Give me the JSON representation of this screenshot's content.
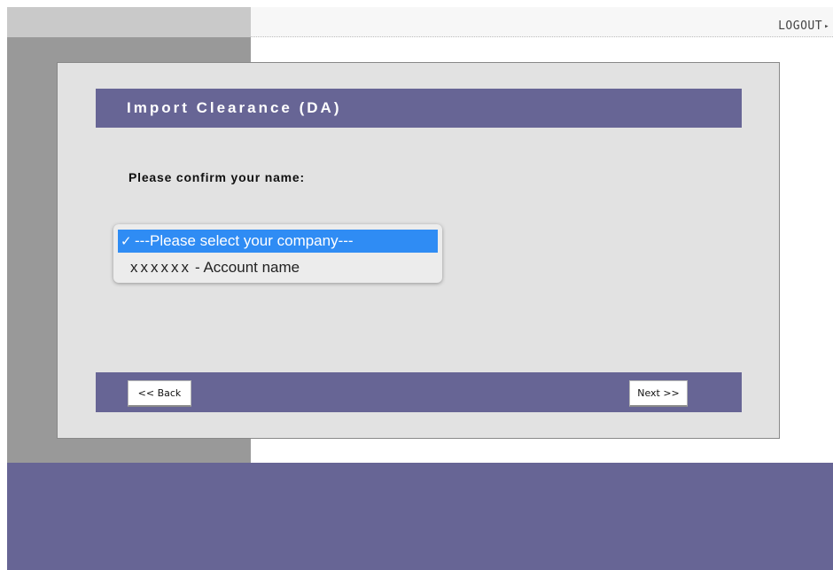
{
  "header": {
    "logout_label": "LOGOUT",
    "logout_arrow": "▸"
  },
  "form": {
    "title": "Import Clearance (DA)",
    "prompt": "Please confirm your name:",
    "company_select": {
      "selected_check": "✓",
      "options": [
        {
          "label": "---Please select your company---",
          "selected": true
        },
        {
          "mask": "xxxxxx",
          "label": "- Account name",
          "selected": false
        }
      ]
    },
    "back_label": "<< Back",
    "next_label": "Next >>"
  },
  "colors": {
    "accent_purple": "#676595",
    "selection_blue": "#2f8cf4",
    "panel_gray": "#e2e2e2",
    "sidebar_gray": "#999999"
  }
}
